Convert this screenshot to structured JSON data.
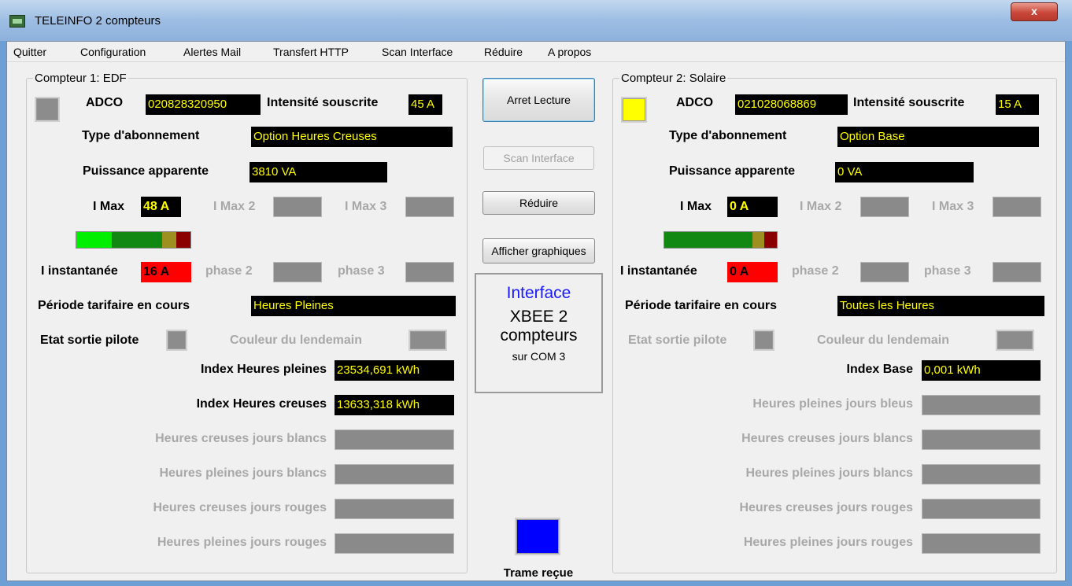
{
  "window": {
    "title": "TELEINFO 2 compteurs",
    "close_glyph": "x"
  },
  "menu": [
    "Quitter",
    "Configuration",
    "Alertes Mail",
    "Transfert HTTP",
    "Scan Interface",
    "Réduire",
    "A propos"
  ],
  "labels": {
    "adco": "ADCO",
    "intensite": "Intensité souscrite",
    "type": "Type d'abonnement",
    "puissance": "Puissance apparente",
    "imax": "I Max",
    "imax2": "I Max 2",
    "imax3": "I Max 3",
    "iinst": "I instantanée",
    "phase2": "phase 2",
    "phase3": "phase 3",
    "periode": "Période tarifaire en cours",
    "etat": "Etat sortie pilote",
    "couleur": "Couleur du lendemain"
  },
  "meter1": {
    "legend": "Compteur 1: EDF",
    "adco": "020828320950",
    "intensite": "45 A",
    "type": "Option Heures Creuses",
    "puissance": "3810 VA",
    "imax": "48 A",
    "iinst": "16 A",
    "periode": "Heures Pleines",
    "index_rows": [
      {
        "label": "Index Heures pleines",
        "value": "23534,691 kWh",
        "enabled": true
      },
      {
        "label": "Index Heures creuses",
        "value": "13633,318 kWh",
        "enabled": true
      },
      {
        "label": "Heures creuses jours blancs",
        "value": "",
        "enabled": false
      },
      {
        "label": "Heures pleines jours blancs",
        "value": "",
        "enabled": false
      },
      {
        "label": "Heures creuses jours rouges",
        "value": "",
        "enabled": false
      },
      {
        "label": "Heures pleines jours rouges",
        "value": "",
        "enabled": false
      }
    ],
    "status_color": "#8c8c8c",
    "gauge_colors": [
      "#00ee00",
      "#118811",
      "#9e9020",
      "#8a0000"
    ]
  },
  "meter2": {
    "legend": "Compteur 2: Solaire",
    "adco": "021028068869",
    "intensite": "15 A",
    "type": "Option Base",
    "puissance": "0 VA",
    "imax": "0 A",
    "iinst": "0 A",
    "periode": "Toutes les Heures",
    "index_rows": [
      {
        "label": "Index Base",
        "value": "0,001 kWh",
        "enabled": true
      },
      {
        "label": "Heures pleines jours bleus",
        "value": "",
        "enabled": false
      },
      {
        "label": "Heures creuses jours blancs",
        "value": "",
        "enabled": false
      },
      {
        "label": "Heures pleines jours blancs",
        "value": "",
        "enabled": false
      },
      {
        "label": "Heures creuses jours rouges",
        "value": "",
        "enabled": false
      },
      {
        "label": "Heures pleines jours rouges",
        "value": "",
        "enabled": false
      }
    ],
    "status_color": "#ffff00",
    "gauge_colors": [
      "#118811",
      "#9e9020",
      "#8a0000"
    ]
  },
  "buttons": {
    "arret": "Arret Lecture",
    "scan": "Scan Interface",
    "reduire": "Réduire",
    "graph": "Afficher graphiques"
  },
  "interface": {
    "title": "Interface",
    "line1": "XBEE 2",
    "line2": "compteurs",
    "port": "sur COM 3",
    "title_color": "#1a1aff"
  },
  "trame": {
    "label": "Trame reçue",
    "color": "#0000ff"
  }
}
